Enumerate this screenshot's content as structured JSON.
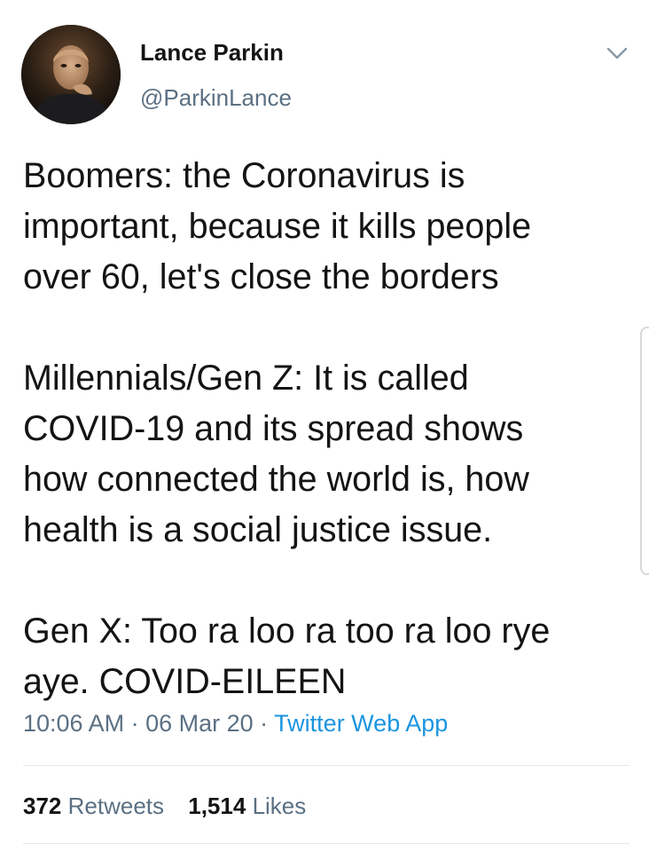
{
  "author": {
    "display_name": "Lance Parkin",
    "handle": "@ParkinLance",
    "avatar_icon": "user-avatar-photo"
  },
  "menu_icon": "chevron-down-icon",
  "tweet": {
    "paragraphs": [
      "Boomers: the Coronavirus is\nimportant, because it kills people\nover 60, let's close the borders",
      "Millennials/Gen Z: It is called\nCOVID-19 and its spread shows\nhow connected the world is, how\nhealth is a social justice issue.",
      "Gen X: Too ra loo ra too ra loo rye\naye. COVID-EILEEN"
    ]
  },
  "meta": {
    "time": "10:06 AM",
    "separator": " · ",
    "date": "06 Mar 20",
    "source": "Twitter Web App"
  },
  "stats": {
    "retweets_count": "372",
    "retweets_label": "Retweets",
    "likes_count": "1,514",
    "likes_label": "Likes"
  },
  "colors": {
    "text": "#141414",
    "secondary": "#5b7083",
    "link": "#1b95e0",
    "divider": "#e1e8ed"
  }
}
